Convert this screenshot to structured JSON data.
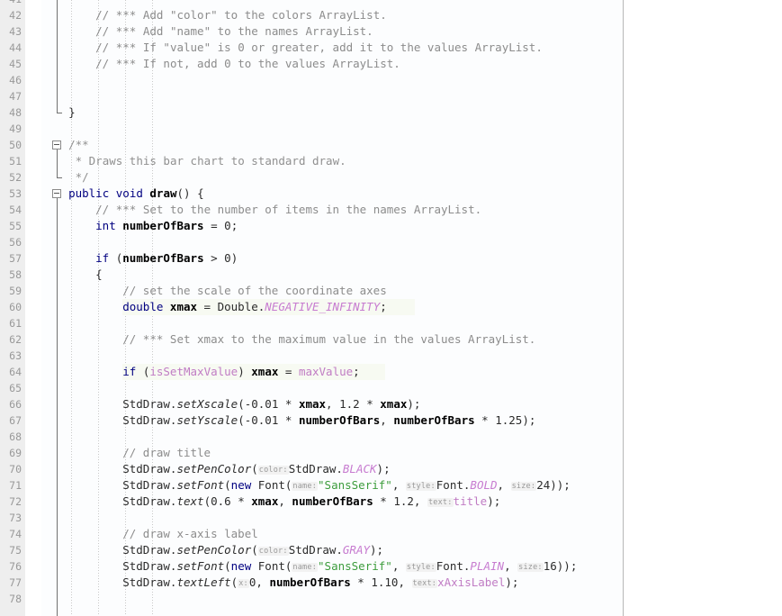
{
  "editor": {
    "language": "Java",
    "first_visible_line": 41,
    "last_visible_line": 78,
    "line_height_px": 18,
    "right_margin_column_guide": true,
    "colors": {
      "background": "#ffffff",
      "gutter_background": "#eeeeee",
      "line_number": "#999999",
      "comment": "#8c8c8c",
      "keyword": "#000080",
      "string": "#3c9c3c",
      "field": "#c07cc4",
      "constant": "#c77cd0",
      "parameter_hint": "#999999",
      "margin_guide": "#b8b8b8",
      "indent_guide": "#c9c9c9",
      "highlight_band": "#f7faf2"
    }
  },
  "fold_markers": [
    {
      "line": 50,
      "state": "expanded",
      "glyph": "minus-box"
    },
    {
      "line": 53,
      "state": "expanded",
      "glyph": "minus-box"
    }
  ],
  "lines": [
    {
      "n": 41,
      "indent": 0,
      "tokens": []
    },
    {
      "n": 42,
      "indent": 8,
      "tokens": [
        {
          "t": "// *** Add \"color\" to the colors ArrayList.",
          "c": "cmt"
        }
      ]
    },
    {
      "n": 43,
      "indent": 8,
      "tokens": [
        {
          "t": "// *** Add \"name\" to the names ArrayList.",
          "c": "cmt"
        }
      ]
    },
    {
      "n": 44,
      "indent": 8,
      "tokens": [
        {
          "t": "// *** If \"value\" is 0 or greater, add it to the values ArrayList.",
          "c": "cmt"
        }
      ]
    },
    {
      "n": 45,
      "indent": 8,
      "tokens": [
        {
          "t": "// *** If not, add 0 to the values ArrayList.",
          "c": "cmt"
        }
      ]
    },
    {
      "n": 46,
      "indent": 0,
      "tokens": []
    },
    {
      "n": 47,
      "indent": 0,
      "tokens": []
    },
    {
      "n": 48,
      "indent": 4,
      "tokens": [
        {
          "t": "}",
          "c": "punc"
        }
      ]
    },
    {
      "n": 49,
      "indent": 0,
      "tokens": []
    },
    {
      "n": 50,
      "indent": 4,
      "tokens": [
        {
          "t": "/**",
          "c": "doc"
        }
      ]
    },
    {
      "n": 51,
      "indent": 4,
      "tokens": [
        {
          "t": " * Draws this bar chart to standard draw.",
          "c": "doc"
        }
      ]
    },
    {
      "n": 52,
      "indent": 4,
      "tokens": [
        {
          "t": " */",
          "c": "doc"
        }
      ]
    },
    {
      "n": 53,
      "indent": 4,
      "tokens": [
        {
          "t": "public",
          "c": "kw"
        },
        {
          "t": " ",
          "c": "punc"
        },
        {
          "t": "void",
          "c": "kw"
        },
        {
          "t": " ",
          "c": "punc"
        },
        {
          "t": "draw",
          "c": "decl"
        },
        {
          "t": "() {",
          "c": "punc"
        }
      ]
    },
    {
      "n": 54,
      "indent": 8,
      "tokens": [
        {
          "t": "// *** Set to the number of items in the names ArrayList.",
          "c": "cmt"
        }
      ]
    },
    {
      "n": 55,
      "indent": 8,
      "tokens": [
        {
          "t": "int",
          "c": "kw"
        },
        {
          "t": " ",
          "c": "punc"
        },
        {
          "t": "numberOfBars",
          "c": "decl"
        },
        {
          "t": " = ",
          "c": "punc"
        },
        {
          "t": "0",
          "c": "num"
        },
        {
          "t": ";",
          "c": "punc"
        }
      ]
    },
    {
      "n": 56,
      "indent": 0,
      "tokens": []
    },
    {
      "n": 57,
      "indent": 8,
      "tokens": [
        {
          "t": "if",
          "c": "kw"
        },
        {
          "t": " (",
          "c": "punc"
        },
        {
          "t": "numberOfBars",
          "c": "decl"
        },
        {
          "t": " > ",
          "c": "punc"
        },
        {
          "t": "0",
          "c": "num"
        },
        {
          "t": ")",
          "c": "punc"
        }
      ]
    },
    {
      "n": 58,
      "indent": 8,
      "tokens": [
        {
          "t": "{",
          "c": "punc"
        }
      ]
    },
    {
      "n": 59,
      "indent": 12,
      "tokens": [
        {
          "t": "// set the scale of the coordinate axes",
          "c": "cmt"
        }
      ]
    },
    {
      "n": 60,
      "indent": 12,
      "highlight": true,
      "highlight_width": 325,
      "tokens": [
        {
          "t": "double",
          "c": "kw"
        },
        {
          "t": " ",
          "c": "punc"
        },
        {
          "t": "xmax",
          "c": "decl"
        },
        {
          "t": " = ",
          "c": "punc"
        },
        {
          "t": "Double",
          "c": "cls"
        },
        {
          "t": ".",
          "c": "punc"
        },
        {
          "t": "NEGATIVE_INFINITY",
          "c": "const"
        },
        {
          "t": ";",
          "c": "punc"
        }
      ]
    },
    {
      "n": 61,
      "indent": 0,
      "tokens": []
    },
    {
      "n": 62,
      "indent": 12,
      "tokens": [
        {
          "t": "// *** Set xmax to the maximum value in the values ArrayList.",
          "c": "cmt"
        }
      ]
    },
    {
      "n": 63,
      "indent": 0,
      "tokens": []
    },
    {
      "n": 64,
      "indent": 12,
      "highlight": true,
      "highlight_width": 292,
      "tokens": [
        {
          "t": "if",
          "c": "kw"
        },
        {
          "t": " (",
          "c": "punc"
        },
        {
          "t": "isSetMaxValue",
          "c": "fld"
        },
        {
          "t": ") ",
          "c": "punc"
        },
        {
          "t": "xmax",
          "c": "decl"
        },
        {
          "t": " = ",
          "c": "punc"
        },
        {
          "t": "maxValue",
          "c": "fld"
        },
        {
          "t": ";",
          "c": "punc"
        }
      ]
    },
    {
      "n": 65,
      "indent": 0,
      "tokens": []
    },
    {
      "n": 66,
      "indent": 12,
      "tokens": [
        {
          "t": "StdDraw",
          "c": "cls"
        },
        {
          "t": ".",
          "c": "punc"
        },
        {
          "t": "setXscale",
          "c": "mth"
        },
        {
          "t": "(-",
          "c": "punc"
        },
        {
          "t": "0.01",
          "c": "num"
        },
        {
          "t": " * ",
          "c": "punc"
        },
        {
          "t": "xmax",
          "c": "decl"
        },
        {
          "t": ", ",
          "c": "punc"
        },
        {
          "t": "1.2",
          "c": "num"
        },
        {
          "t": " * ",
          "c": "punc"
        },
        {
          "t": "xmax",
          "c": "decl"
        },
        {
          "t": ");",
          "c": "punc"
        }
      ]
    },
    {
      "n": 67,
      "indent": 12,
      "tokens": [
        {
          "t": "StdDraw",
          "c": "cls"
        },
        {
          "t": ".",
          "c": "punc"
        },
        {
          "t": "setYscale",
          "c": "mth"
        },
        {
          "t": "(-",
          "c": "punc"
        },
        {
          "t": "0.01",
          "c": "num"
        },
        {
          "t": " * ",
          "c": "punc"
        },
        {
          "t": "numberOfBars",
          "c": "decl"
        },
        {
          "t": ", ",
          "c": "punc"
        },
        {
          "t": "numberOfBars",
          "c": "decl"
        },
        {
          "t": " * ",
          "c": "punc"
        },
        {
          "t": "1.25",
          "c": "num"
        },
        {
          "t": ");",
          "c": "punc"
        }
      ]
    },
    {
      "n": 68,
      "indent": 0,
      "tokens": []
    },
    {
      "n": 69,
      "indent": 12,
      "tokens": [
        {
          "t": "// draw title",
          "c": "cmt"
        }
      ]
    },
    {
      "n": 70,
      "indent": 12,
      "tokens": [
        {
          "t": "StdDraw",
          "c": "cls"
        },
        {
          "t": ".",
          "c": "punc"
        },
        {
          "t": "setPenColor",
          "c": "mth"
        },
        {
          "t": "(",
          "c": "punc"
        },
        {
          "t": "color:",
          "c": "hint"
        },
        {
          "t": "StdDraw",
          "c": "cls"
        },
        {
          "t": ".",
          "c": "punc"
        },
        {
          "t": "BLACK",
          "c": "const"
        },
        {
          "t": ");",
          "c": "punc"
        }
      ]
    },
    {
      "n": 71,
      "indent": 12,
      "tokens": [
        {
          "t": "StdDraw",
          "c": "cls"
        },
        {
          "t": ".",
          "c": "punc"
        },
        {
          "t": "setFont",
          "c": "mth"
        },
        {
          "t": "(",
          "c": "punc"
        },
        {
          "t": "new",
          "c": "kw"
        },
        {
          "t": " ",
          "c": "punc"
        },
        {
          "t": "Font",
          "c": "cls"
        },
        {
          "t": "(",
          "c": "punc"
        },
        {
          "t": "name:",
          "c": "hint"
        },
        {
          "t": "\"SansSerif\"",
          "c": "str"
        },
        {
          "t": ", ",
          "c": "punc"
        },
        {
          "t": "style:",
          "c": "hint"
        },
        {
          "t": "Font",
          "c": "cls"
        },
        {
          "t": ".",
          "c": "punc"
        },
        {
          "t": "BOLD",
          "c": "const"
        },
        {
          "t": ", ",
          "c": "punc"
        },
        {
          "t": "size:",
          "c": "hint"
        },
        {
          "t": "24",
          "c": "num"
        },
        {
          "t": "));",
          "c": "punc"
        }
      ]
    },
    {
      "n": 72,
      "indent": 12,
      "tokens": [
        {
          "t": "StdDraw",
          "c": "cls"
        },
        {
          "t": ".",
          "c": "punc"
        },
        {
          "t": "text",
          "c": "mth"
        },
        {
          "t": "(",
          "c": "punc"
        },
        {
          "t": "0.6",
          "c": "num"
        },
        {
          "t": " * ",
          "c": "punc"
        },
        {
          "t": "xmax",
          "c": "decl"
        },
        {
          "t": ", ",
          "c": "punc"
        },
        {
          "t": "numberOfBars",
          "c": "decl"
        },
        {
          "t": " * ",
          "c": "punc"
        },
        {
          "t": "1.2",
          "c": "num"
        },
        {
          "t": ", ",
          "c": "punc"
        },
        {
          "t": "text:",
          "c": "hint"
        },
        {
          "t": "title",
          "c": "fld"
        },
        {
          "t": ");",
          "c": "punc"
        }
      ]
    },
    {
      "n": 73,
      "indent": 0,
      "tokens": []
    },
    {
      "n": 74,
      "indent": 12,
      "tokens": [
        {
          "t": "// draw x-axis label",
          "c": "cmt"
        }
      ]
    },
    {
      "n": 75,
      "indent": 12,
      "tokens": [
        {
          "t": "StdDraw",
          "c": "cls"
        },
        {
          "t": ".",
          "c": "punc"
        },
        {
          "t": "setPenColor",
          "c": "mth"
        },
        {
          "t": "(",
          "c": "punc"
        },
        {
          "t": "color:",
          "c": "hint"
        },
        {
          "t": "StdDraw",
          "c": "cls"
        },
        {
          "t": ".",
          "c": "punc"
        },
        {
          "t": "GRAY",
          "c": "const"
        },
        {
          "t": ");",
          "c": "punc"
        }
      ]
    },
    {
      "n": 76,
      "indent": 12,
      "tokens": [
        {
          "t": "StdDraw",
          "c": "cls"
        },
        {
          "t": ".",
          "c": "punc"
        },
        {
          "t": "setFont",
          "c": "mth"
        },
        {
          "t": "(",
          "c": "punc"
        },
        {
          "t": "new",
          "c": "kw"
        },
        {
          "t": " ",
          "c": "punc"
        },
        {
          "t": "Font",
          "c": "cls"
        },
        {
          "t": "(",
          "c": "punc"
        },
        {
          "t": "name:",
          "c": "hint"
        },
        {
          "t": "\"SansSerif\"",
          "c": "str"
        },
        {
          "t": ", ",
          "c": "punc"
        },
        {
          "t": "style:",
          "c": "hint"
        },
        {
          "t": "Font",
          "c": "cls"
        },
        {
          "t": ".",
          "c": "punc"
        },
        {
          "t": "PLAIN",
          "c": "const"
        },
        {
          "t": ", ",
          "c": "punc"
        },
        {
          "t": "size:",
          "c": "hint"
        },
        {
          "t": "16",
          "c": "num"
        },
        {
          "t": "));",
          "c": "punc"
        }
      ]
    },
    {
      "n": 77,
      "indent": 12,
      "tokens": [
        {
          "t": "StdDraw",
          "c": "cls"
        },
        {
          "t": ".",
          "c": "punc"
        },
        {
          "t": "textLeft",
          "c": "mth"
        },
        {
          "t": "(",
          "c": "punc"
        },
        {
          "t": "x:",
          "c": "hint"
        },
        {
          "t": "0",
          "c": "num"
        },
        {
          "t": ", ",
          "c": "punc"
        },
        {
          "t": "numberOfBars",
          "c": "decl"
        },
        {
          "t": " * ",
          "c": "punc"
        },
        {
          "t": "1.10",
          "c": "num"
        },
        {
          "t": ", ",
          "c": "punc"
        },
        {
          "t": "text:",
          "c": "hint"
        },
        {
          "t": "xAxisLabel",
          "c": "fld"
        },
        {
          "t": ");",
          "c": "punc"
        }
      ]
    },
    {
      "n": 78,
      "indent": 0,
      "tokens": []
    }
  ]
}
